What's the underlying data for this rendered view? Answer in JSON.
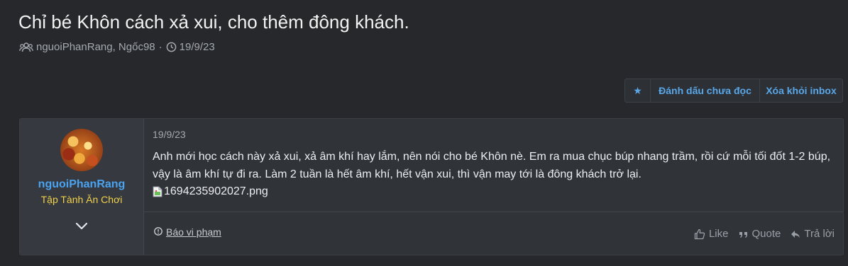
{
  "thread": {
    "title": "Chỉ bé Khôn cách xả xui, cho thêm đông khách.",
    "participants": "nguoiPhanRang, Ngốc98",
    "separator": "·",
    "date": "19/9/23",
    "participants_icon": "users-icon",
    "date_icon": "clock-icon"
  },
  "actions": {
    "star_icon": "star-icon",
    "star_label": "★",
    "mark_unread": "Đánh dấu chưa đọc",
    "remove_inbox": "Xóa khỏi inbox"
  },
  "message": {
    "author": {
      "username": "nguoiPhanRang",
      "title": "Tập Tành Ăn Chơi"
    },
    "date": "19/9/23",
    "body": "Anh mới học cách này xả xui, xả âm khí hay lắm, nên nói cho bé Khôn nè. Em ra mua chục búp nhang trầm, rồi cứ mỗi tối đốt 1-2 búp, vậy là âm khí tự đi ra. Làm 2 tuần là hết âm khí, hết vận xui, thì vận may tới là đông khách trở lại.",
    "attachment": "1694235902027.png",
    "report": "Báo vi phạm",
    "like": "Like",
    "quote": "Quote",
    "reply": "Trả lời"
  },
  "colors": {
    "background": "#26282b",
    "accent": "#5aa7e8",
    "username": "#4aa3f0",
    "user_title": "#f1d24b"
  }
}
